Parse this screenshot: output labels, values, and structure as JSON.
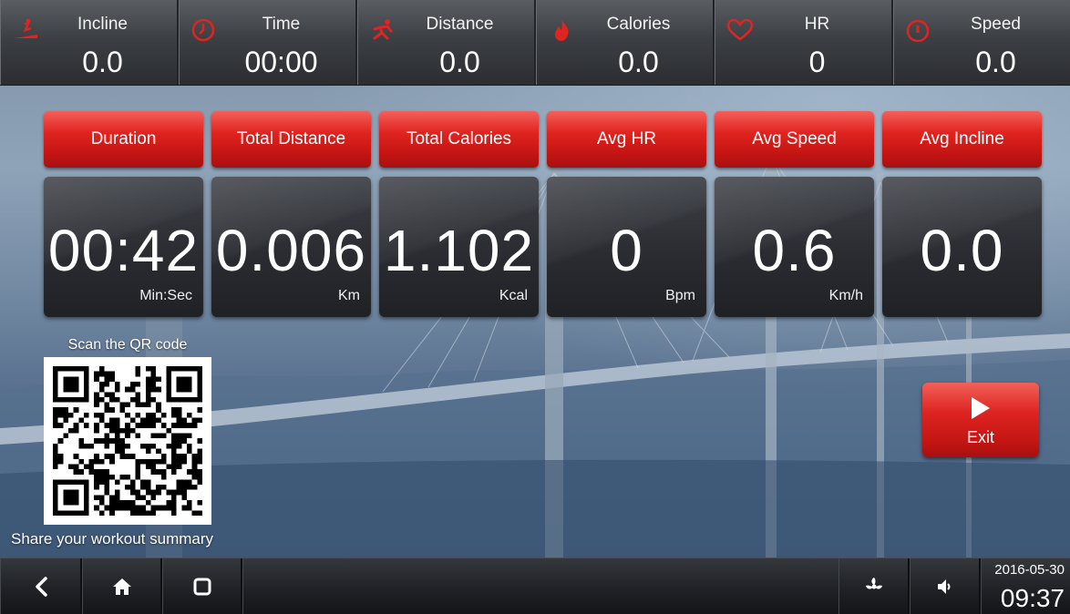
{
  "topbar": {
    "stats": [
      {
        "label": "Incline",
        "value": "0.0",
        "icon": "incline-icon"
      },
      {
        "label": "Time",
        "value": "00:00",
        "icon": "clock-icon"
      },
      {
        "label": "Distance",
        "value": "0.0",
        "icon": "runner-icon"
      },
      {
        "label": "Calories",
        "value": "0.0",
        "icon": "flame-icon"
      },
      {
        "label": "HR",
        "value": "0",
        "icon": "heart-icon"
      },
      {
        "label": "Speed",
        "value": "0.0",
        "icon": "speedometer-icon"
      }
    ]
  },
  "summary": {
    "cards": [
      {
        "title": "Duration",
        "value": "00:42",
        "unit": "Min:Sec"
      },
      {
        "title": "Total Distance",
        "value": "0.006",
        "unit": "Km"
      },
      {
        "title": "Total Calories",
        "value": "1.102",
        "unit": "Kcal"
      },
      {
        "title": "Avg HR",
        "value": "0",
        "unit": "Bpm"
      },
      {
        "title": "Avg Speed",
        "value": "0.6",
        "unit": "Km/h"
      },
      {
        "title": "Avg Incline",
        "value": "0.0",
        "unit": ""
      }
    ]
  },
  "qr": {
    "caption": "Scan the QR code",
    "share": "Share your workout summary"
  },
  "exit": {
    "label": "Exit",
    "icon": "play-icon"
  },
  "navbar": {
    "back_icon": "back-icon",
    "home_icon": "home-icon",
    "recents_icon": "recents-icon",
    "fan_icon": "fan-icon",
    "volume_icon": "volume-icon",
    "date": "2016-05-30",
    "time": "09:37"
  },
  "colors": {
    "accent_red": "#e02420",
    "panel_dark": "#2a2c31",
    "top_bar": "#3c3f44"
  }
}
